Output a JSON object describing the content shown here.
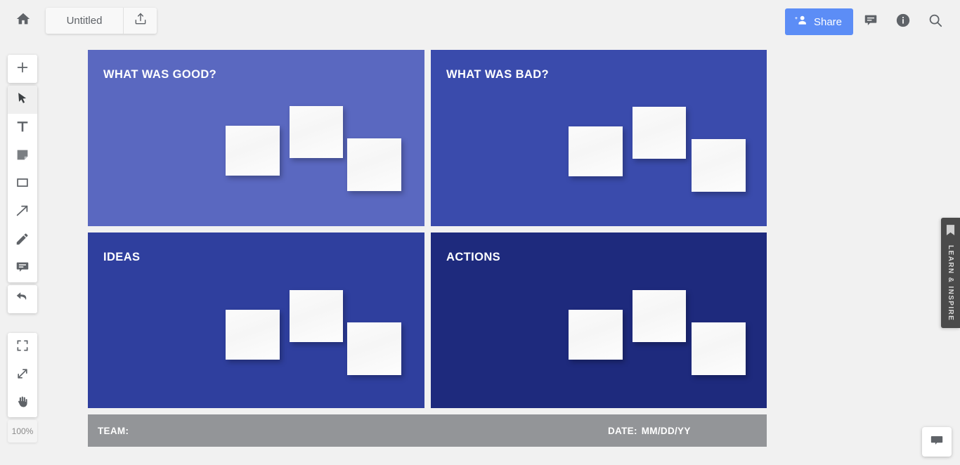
{
  "app": {
    "background_color": "#f1f1f1"
  },
  "topbar": {
    "home_icon": "home-icon",
    "document_title": "Untitled",
    "document_title_placeholder": "Untitled",
    "export_icon": "upload-export-icon",
    "share_label": "Share",
    "share_icon": "add-person-icon",
    "share_color": "#5c8df6",
    "comments_icon": "comment-icon",
    "info_icon": "info-icon",
    "search_icon": "search-icon"
  },
  "left_toolbar": {
    "groups": [
      {
        "items": [
          {
            "name": "add-button",
            "icon": "plus-icon",
            "selected": false
          }
        ]
      },
      {
        "items": [
          {
            "name": "select-tool",
            "icon": "cursor-arrow-icon",
            "selected": true
          },
          {
            "name": "text-tool",
            "icon": "text-t-icon",
            "selected": false
          },
          {
            "name": "sticky-note-tool",
            "icon": "sticky-note-icon",
            "selected": false
          },
          {
            "name": "shape-tool",
            "icon": "square-icon",
            "selected": false
          },
          {
            "name": "arrow-tool",
            "icon": "arrow-diagonal-icon",
            "selected": false
          },
          {
            "name": "pen-tool",
            "icon": "pencil-icon",
            "selected": false
          },
          {
            "name": "comment-tool",
            "icon": "comment-icon",
            "selected": false
          }
        ]
      },
      {
        "items": [
          {
            "name": "undo-button",
            "icon": "undo-arrow-icon",
            "selected": false
          }
        ]
      },
      {
        "items": [
          {
            "name": "fit-to-screen-button",
            "icon": "fit-frame-icon",
            "selected": false
          },
          {
            "name": "zoom-expand-button",
            "icon": "expand-diagonal-icon",
            "selected": false
          },
          {
            "name": "pan-hand-tool",
            "icon": "hand-icon",
            "selected": false
          }
        ]
      }
    ],
    "zoom_level": "100%"
  },
  "board": {
    "quadrants": [
      {
        "id": "good",
        "title": "WHAT WAS GOOD?",
        "color": "#5a68c0"
      },
      {
        "id": "bad",
        "title": "WHAT WAS BAD?",
        "color": "#3a4bac"
      },
      {
        "id": "ideas",
        "title": "IDEAS",
        "color": "#2f3f9e"
      },
      {
        "id": "actions",
        "title": "ACTIONS",
        "color": "#1e2a7d"
      }
    ],
    "notes_per_quadrant": 3,
    "footer": {
      "team_label": "TEAM:",
      "team_value": "",
      "date_label": "DATE:",
      "date_value": "MM/DD/YY",
      "color": "#939598"
    }
  },
  "side_panel": {
    "tab_label": "LEARN & INSPIRE",
    "bookmark_icon": "bookmark-icon"
  },
  "chat": {
    "icon": "chat-bubble-icon"
  }
}
